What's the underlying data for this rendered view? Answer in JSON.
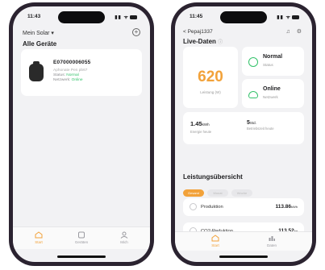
{
  "left": {
    "time": "11:43",
    "plant_selector": "Mein Solar ▾",
    "add_icon": "plus-circle-icon",
    "section_title": "Alle Geräte",
    "device": {
      "serial": "E07000006055",
      "line1": "Aphonate Pen pb67",
      "line2_label": "Status:",
      "line2_value": "Normal",
      "line3_label": "Netzwerk:",
      "line3_value": "Online"
    },
    "tabs": [
      {
        "label": "Start",
        "icon": "home-icon"
      },
      {
        "label": "Geräten",
        "icon": "device-icon"
      },
      {
        "label": "Mich",
        "icon": "user-icon"
      }
    ]
  },
  "right": {
    "time": "11:45",
    "back_label": "< Pepaj1337",
    "header_icons": "♫ ⚙",
    "live_title": "Live-Daten",
    "live_hint": "ⓘ",
    "power_value": "620",
    "power_label": "Leistung (W)",
    "status_value": "Normal",
    "status_label": "Status",
    "network_value": "Online",
    "network_label": "Netzwerk",
    "kpi1_value": "1.45",
    "kpi1_unit": "kWh",
    "kpi1_label": "Energie heute",
    "kpi2_value": "5",
    "kpi2_unit": "Std.",
    "kpi2_label": "Betriebszeit heute",
    "overview_title": "Leistungsübersicht",
    "chips": [
      "Gesamt",
      "Monat",
      "Woche"
    ],
    "rows": [
      {
        "label": "Produktion",
        "value": "113.86",
        "unit": "kWh",
        "icon": "sun-icon"
      },
      {
        "label": "CO2-Reduktion",
        "value": "113.52",
        "unit": "kg",
        "icon": "cloud-icon"
      }
    ],
    "tabs": [
      {
        "label": "Start",
        "icon": "home-icon"
      },
      {
        "label": "Daten",
        "icon": "chart-icon"
      }
    ]
  },
  "colors": {
    "accent": "#f2a23a",
    "ok": "#33c26a",
    "frame": "#2b2330"
  }
}
